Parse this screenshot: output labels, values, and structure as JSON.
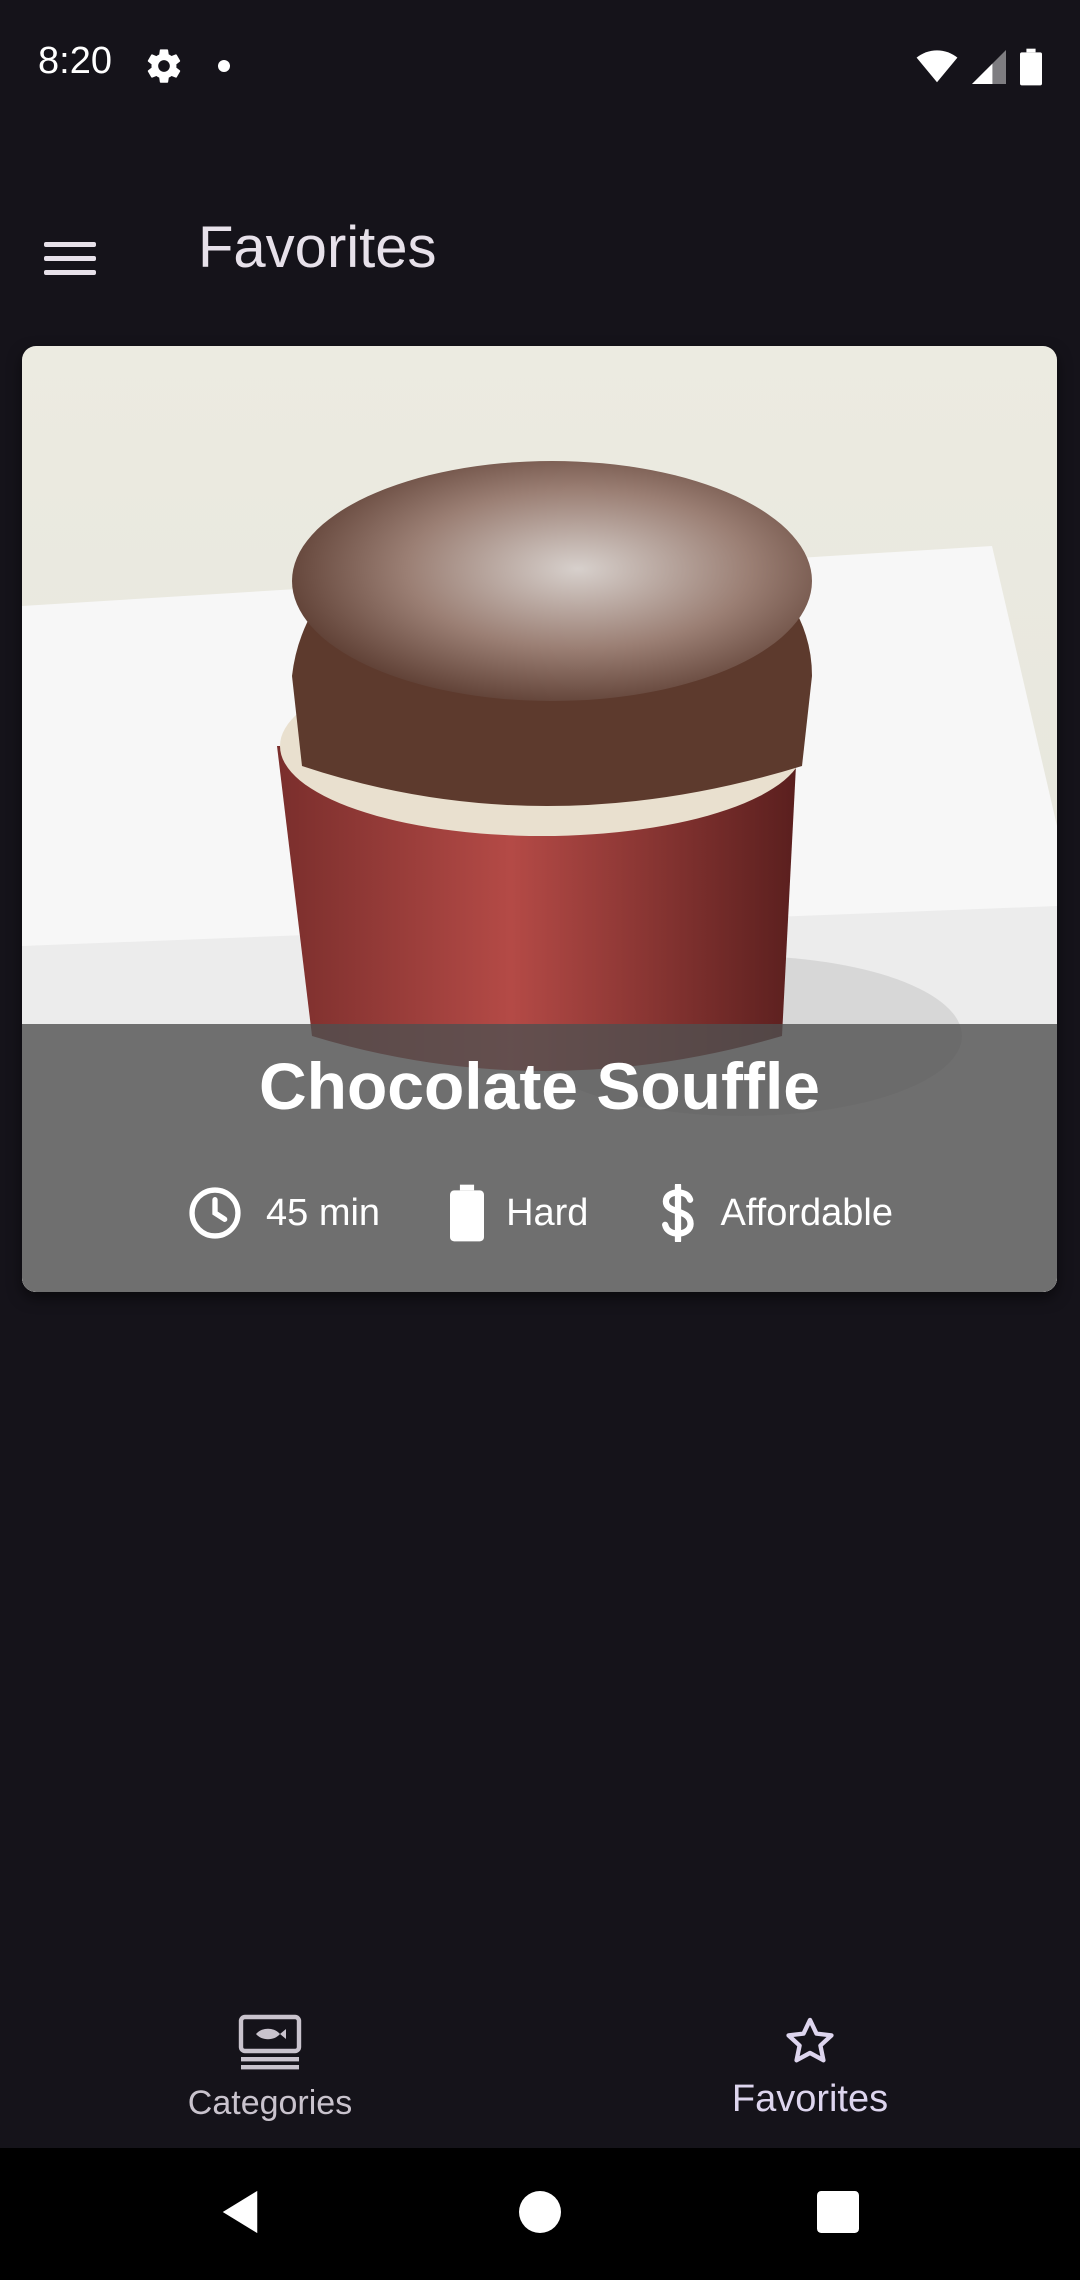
{
  "status_bar": {
    "time": "8:20",
    "icons": [
      "gear-icon",
      "notification-dot",
      "wifi-icon",
      "signal-icon",
      "battery-icon"
    ]
  },
  "app_bar": {
    "title": "Favorites",
    "menu_icon": "menu-icon"
  },
  "meal": {
    "title": "Chocolate Souffle",
    "duration": "45 min",
    "complexity": "Hard",
    "affordability": "Affordable",
    "icons": {
      "duration": "clock-icon",
      "complexity": "battery-icon",
      "affordability": "dollar-icon"
    }
  },
  "bottom_nav": {
    "items": [
      {
        "label": "Categories",
        "icon": "set-meal-icon",
        "selected": false
      },
      {
        "label": "Favorites",
        "icon": "star-outline-icon",
        "selected": true
      }
    ]
  },
  "system_nav": {
    "buttons": [
      "back-icon",
      "home-icon",
      "recents-icon"
    ]
  },
  "colors": {
    "background": "#15131a",
    "text": "#e7e1ea",
    "overlay": "#505050",
    "selected_nav": "#ddd5ee"
  }
}
